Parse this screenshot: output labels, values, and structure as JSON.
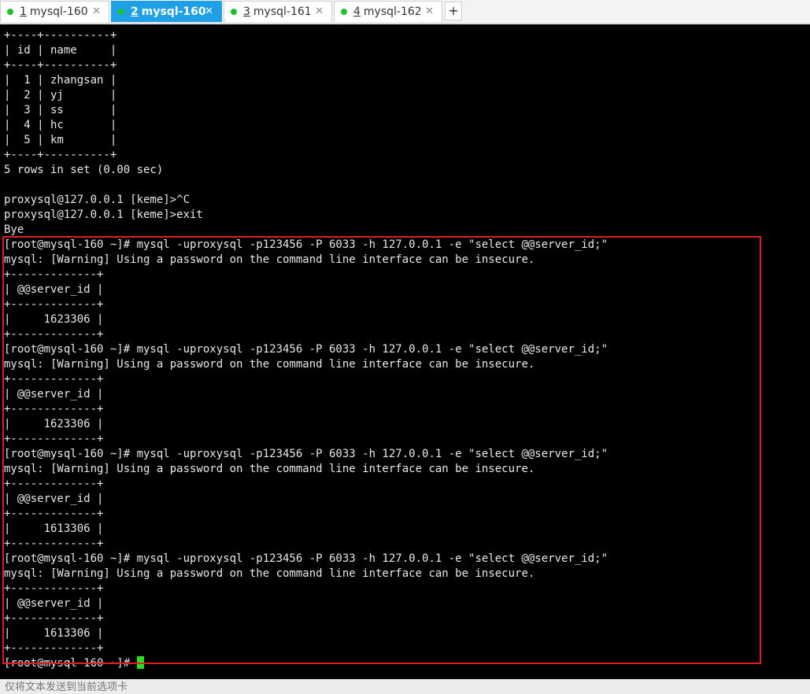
{
  "tabs": [
    {
      "num": "1",
      "label": "mysql-160",
      "close": "✕",
      "active": false
    },
    {
      "num": "2",
      "label": "mysql-160",
      "close": "✕",
      "active": true
    },
    {
      "num": "3",
      "label": "mysql-161",
      "close": "✕",
      "active": false
    },
    {
      "num": "4",
      "label": "mysql-162",
      "close": "✕",
      "active": false
    }
  ],
  "add_tab_label": "+",
  "terminal": {
    "lines": [
      "+----+----------+",
      "| id | name     |",
      "+----+----------+",
      "|  1 | zhangsan |",
      "|  2 | yj       |",
      "|  3 | ss       |",
      "|  4 | hc       |",
      "|  5 | km       |",
      "+----+----------+",
      "5 rows in set (0.00 sec)",
      "",
      "proxysql@127.0.0.1 [keme]>^C",
      "proxysql@127.0.0.1 [keme]>exit",
      "Bye",
      "[root@mysql-160 ~]# mysql -uproxysql -p123456 -P 6033 -h 127.0.0.1 -e \"select @@server_id;\"",
      "mysql: [Warning] Using a password on the command line interface can be insecure.",
      "+-------------+",
      "| @@server_id |",
      "+-------------+",
      "|     1623306 |",
      "+-------------+",
      "[root@mysql-160 ~]# mysql -uproxysql -p123456 -P 6033 -h 127.0.0.1 -e \"select @@server_id;\"",
      "mysql: [Warning] Using a password on the command line interface can be insecure.",
      "+-------------+",
      "| @@server_id |",
      "+-------------+",
      "|     1623306 |",
      "+-------------+",
      "[root@mysql-160 ~]# mysql -uproxysql -p123456 -P 6033 -h 127.0.0.1 -e \"select @@server_id;\"",
      "mysql: [Warning] Using a password on the command line interface can be insecure.",
      "+-------------+",
      "| @@server_id |",
      "+-------------+",
      "|     1613306 |",
      "+-------------+",
      "[root@mysql-160 ~]# mysql -uproxysql -p123456 -P 6033 -h 127.0.0.1 -e \"select @@server_id;\"",
      "mysql: [Warning] Using a password on the command line interface can be insecure.",
      "+-------------+",
      "| @@server_id |",
      "+-------------+",
      "|     1613306 |",
      "+-------------+"
    ],
    "prompt": "[root@mysql-160 ~]# "
  },
  "status": {
    "input_placeholder": "仅将文本发送到当前选项卡"
  },
  "colors": {
    "active_tab": "#1e9fe6",
    "status_dot": "#20c030",
    "cursor": "#22e022",
    "highlight": "#e02020"
  }
}
